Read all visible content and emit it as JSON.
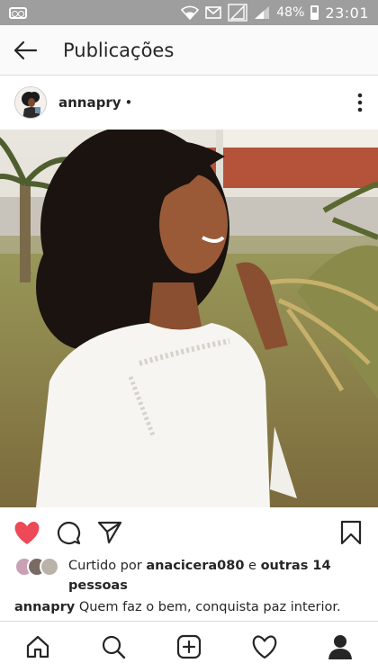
{
  "status_bar": {
    "battery": "48%",
    "time": "23:01",
    "icons": [
      "voicemail-icon",
      "wifi-icon",
      "mail-icon",
      "no-signal-icon",
      "signal-icon",
      "battery-icon"
    ]
  },
  "header": {
    "title": "Publicações",
    "back_icon": "arrow-left-icon"
  },
  "post": {
    "username": "annapry",
    "separator": "•",
    "more_icon": "vertical-dots-icon"
  },
  "actions": {
    "like_icon": "heart-filled-icon",
    "comment_icon": "comment-bubble-icon",
    "share_icon": "paper-plane-icon",
    "save_icon": "bookmark-icon",
    "like_color": "#ed4956"
  },
  "likes": {
    "prefix": "Curtido por",
    "user": "anacicera080",
    "connector": "e",
    "others": "outras 14 pessoas"
  },
  "caption": {
    "username": "annapry",
    "text": "Quem faz o bem, conquista paz interior."
  },
  "bottom_nav": [
    "home-icon",
    "search-icon",
    "new-post-icon",
    "activity-heart-icon",
    "profile-icon"
  ]
}
